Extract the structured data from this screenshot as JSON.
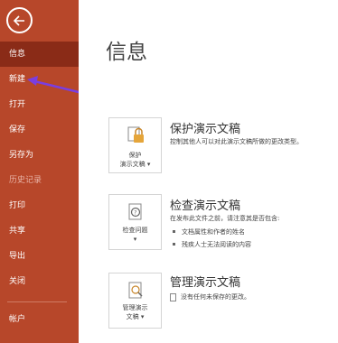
{
  "sidebar": {
    "items": [
      {
        "label": "信息"
      },
      {
        "label": "新建"
      },
      {
        "label": "打开"
      },
      {
        "label": "保存"
      },
      {
        "label": "另存为"
      },
      {
        "label": "历史记录"
      },
      {
        "label": "打印"
      },
      {
        "label": "共享"
      },
      {
        "label": "导出"
      },
      {
        "label": "关闭"
      },
      {
        "label": "帐户"
      }
    ]
  },
  "main": {
    "title": "信息",
    "sections": [
      {
        "button_line1": "保护",
        "button_line2": "演示文稿",
        "title": "保护演示文稿",
        "desc": "控制其他人可以对此演示文稿所做的更改类型。"
      },
      {
        "button_line1": "检查问题",
        "title": "检查演示文稿",
        "desc": "在发布此文件之前，请注意其是否包含:",
        "bullets": [
          "文档属性和作者的姓名",
          "残疾人士无法阅读的内容"
        ]
      },
      {
        "button_line1": "管理演示",
        "button_line2": "文稿",
        "title": "管理演示文稿",
        "status": "没有任何未保存的更改。"
      }
    ]
  },
  "colors": {
    "sidebar": "#b7472a",
    "active": "#8a2b17",
    "arrow": "#7a3ee0"
  }
}
